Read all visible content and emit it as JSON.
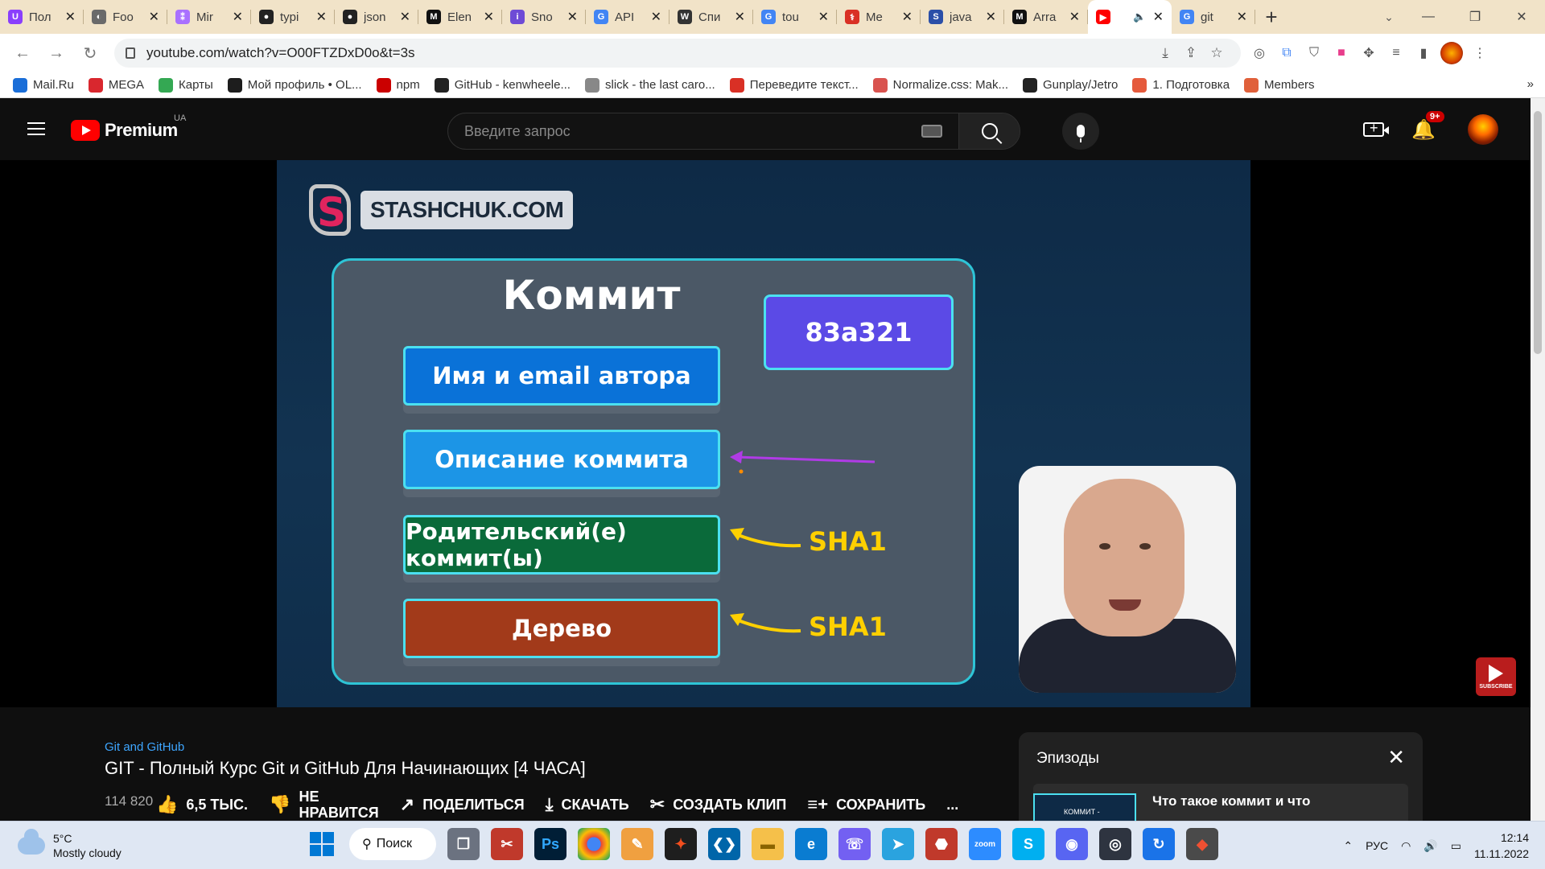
{
  "browser": {
    "tabs": [
      {
        "label": "Пол",
        "color": "#8a3ffc",
        "glyph": "U"
      },
      {
        "label": "Foo",
        "color": "#6a6a6a",
        "glyph": "◐"
      },
      {
        "label": "Mir",
        "color": "#a970ff",
        "glyph": "⁑"
      },
      {
        "label": "typi",
        "color": "#222222",
        "glyph": "●"
      },
      {
        "label": "json",
        "color": "#222222",
        "glyph": "●"
      },
      {
        "label": "Elen",
        "color": "#111111",
        "glyph": "M"
      },
      {
        "label": "Sno",
        "color": "#6e4bd6",
        "glyph": "i"
      },
      {
        "label": "API",
        "color": "#4285f4",
        "glyph": "G"
      },
      {
        "label": "Спи",
        "color": "#333333",
        "glyph": "W"
      },
      {
        "label": "tou",
        "color": "#4285f4",
        "glyph": "G"
      },
      {
        "label": "Me",
        "color": "#d93025",
        "glyph": "⚕"
      },
      {
        "label": "java",
        "color": "#2b4fa8",
        "glyph": "S"
      },
      {
        "label": "Arra",
        "color": "#111111",
        "glyph": "M"
      },
      {
        "label": "",
        "color": "#ff0000",
        "glyph": "▶",
        "active": true
      },
      {
        "label": "git",
        "color": "#4285f4",
        "glyph": "G"
      }
    ],
    "url": "youtube.com/watch?v=O00FTZDxD0o&t=3s",
    "bookmarks": [
      {
        "label": "Mail.Ru",
        "color": "#1a6ed8"
      },
      {
        "label": "MEGA",
        "color": "#d9272e"
      },
      {
        "label": "Карты",
        "color": "#34a853"
      },
      {
        "label": "Мой профиль • OL...",
        "color": "#1d1d1d"
      },
      {
        "label": "npm",
        "color": "#cb0000"
      },
      {
        "label": "GitHub - kenwheele...",
        "color": "#222222"
      },
      {
        "label": "slick - the last caro...",
        "color": "#888888"
      },
      {
        "label": "Переведите текст...",
        "color": "#d93025"
      },
      {
        "label": "Normalize.css: Mak...",
        "color": "#d9534f"
      },
      {
        "label": "Gunplay/Jetro",
        "color": "#222222"
      },
      {
        "label": "1. Подготовка",
        "color": "#e55a3c"
      },
      {
        "label": "Members",
        "color": "#e0603a"
      }
    ],
    "more": "»"
  },
  "youtube": {
    "logo_text": "Premium",
    "region": "UA",
    "search_placeholder": "Введите запрос",
    "notif_count": "9+"
  },
  "slide": {
    "site_name": "STASHCHUK.COM",
    "title": "Коммит",
    "hash": "83a321",
    "fields": [
      "Имя и email автора",
      "Описание коммита",
      "Родительский(е) коммит(ы)",
      "Дерево"
    ],
    "sha_labels": [
      "SHA1",
      "SHA1"
    ],
    "subscribe": "SUBSCRIBE"
  },
  "video": {
    "channel": "Git and GitHub",
    "title": "GIT - Полный Курс Git и GitHub Для Начинающих [4 ЧАСА]",
    "views": "114 820",
    "likes": "6,5 ТЫС.",
    "dislike": [
      "НЕ",
      "НРАВИТСЯ"
    ],
    "share": "ПОДЕЛИТЬСЯ",
    "download": "СКАЧАТЬ",
    "clip": "СОЗДАТЬ КЛИП",
    "save": "СОХРАНИТЬ",
    "more": "..."
  },
  "episodes": {
    "title": "Эпизоды",
    "item": "Что такое коммит и что",
    "thumb": "КОММИТ -"
  },
  "taskbar": {
    "temp": "5°C",
    "weather": "Mostly cloudy",
    "search": "Поиск",
    "lang": "РУС",
    "time": "12:14",
    "date": "11.11.2022"
  }
}
